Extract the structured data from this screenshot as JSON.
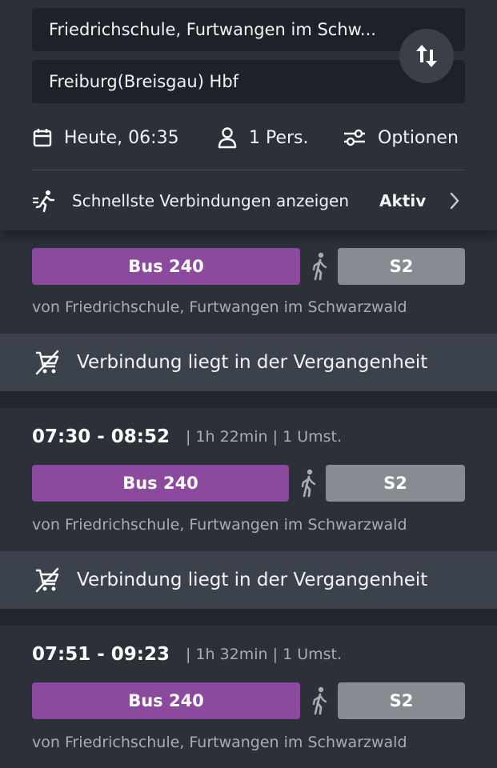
{
  "search": {
    "from": "Friedrichschule, Furtwangen im Schw...",
    "to": "Freiburg(Breisgau) Hbf",
    "swap_icon": "swap-vertical-icon"
  },
  "options": {
    "date": "Heute, 06:35",
    "persons": "1 Pers.",
    "options_label": "Optionen"
  },
  "fastest": {
    "label": "Schnellste Verbindungen anzeigen",
    "status": "Aktiv"
  },
  "colors": {
    "background": "#2b3039",
    "field": "#1e2128",
    "bus": "#8b4a9e",
    "train": "#878b92",
    "banner": "#3b424c",
    "secondary_text": "#a7adb6"
  },
  "connections": [
    {
      "times": "",
      "meta": "",
      "bus": "Bus 240",
      "train": "S2",
      "from": "von Friedrichschule, Furtwangen im Schwarzwald",
      "past_notice": "Verbindung liegt in der Vergangenheit"
    },
    {
      "times": "07:30 - 08:52",
      "meta": "| 1h 22min | 1 Umst.",
      "bus": "Bus 240",
      "train": "S2",
      "from": "von Friedrichschule, Furtwangen im Schwarzwald",
      "past_notice": "Verbindung liegt in der Vergangenheit"
    },
    {
      "times": "07:51 - 09:23",
      "meta": "| 1h 32min | 1 Umst.",
      "bus": "Bus 240",
      "train": "S2",
      "from": "von Friedrichschule, Furtwangen im Schwarzwald"
    }
  ]
}
